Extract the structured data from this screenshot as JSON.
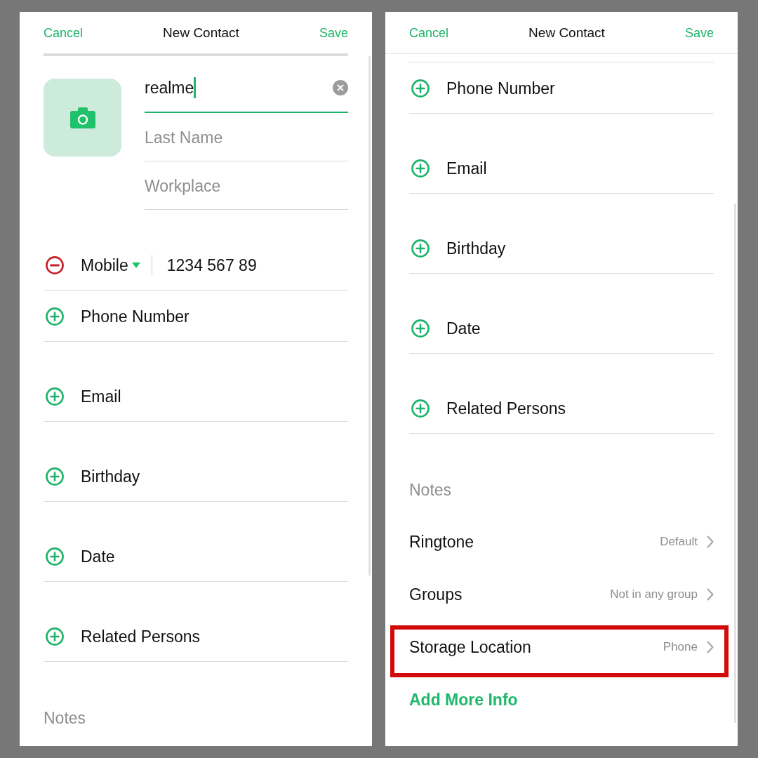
{
  "screens": [
    {
      "header": {
        "cancel": "Cancel",
        "title": "New Contact",
        "save": "Save"
      },
      "scrolled": false,
      "sections": [
        {
          "kind": "name_block",
          "fields": [
            {
              "value": "realme",
              "focused": true
            },
            {
              "placeholder": "Last Name",
              "focused": false
            },
            {
              "placeholder": "Workplace",
              "focused": false
            }
          ]
        },
        {
          "kind": "phone",
          "type": "Mobile",
          "value": "1234 567 89"
        },
        {
          "kind": "add",
          "label": "Phone Number"
        },
        {
          "kind": "add",
          "label": "Email"
        },
        {
          "kind": "add",
          "label": "Birthday"
        },
        {
          "kind": "add",
          "label": "Date"
        },
        {
          "kind": "add",
          "label": "Related Persons"
        },
        {
          "kind": "notes",
          "placeholder": "Notes"
        }
      ]
    },
    {
      "header": {
        "cancel": "Cancel",
        "title": "New Contact",
        "save": "Save"
      },
      "scrolled": true,
      "sections": [
        {
          "kind": "add",
          "label": "Phone Number"
        },
        {
          "kind": "add",
          "label": "Email"
        },
        {
          "kind": "add",
          "label": "Birthday"
        },
        {
          "kind": "add",
          "label": "Date"
        },
        {
          "kind": "add",
          "label": "Related Persons"
        },
        {
          "kind": "notes",
          "placeholder": "Notes"
        },
        {
          "kind": "setting",
          "label": "Ringtone",
          "value": "Default",
          "highlighted": false
        },
        {
          "kind": "setting",
          "label": "Groups",
          "value": "Not in any group",
          "highlighted": false
        },
        {
          "kind": "setting",
          "label": "Storage Location",
          "value": "Phone",
          "highlighted": true
        },
        {
          "kind": "link",
          "label": "Add More Info"
        }
      ]
    }
  ]
}
